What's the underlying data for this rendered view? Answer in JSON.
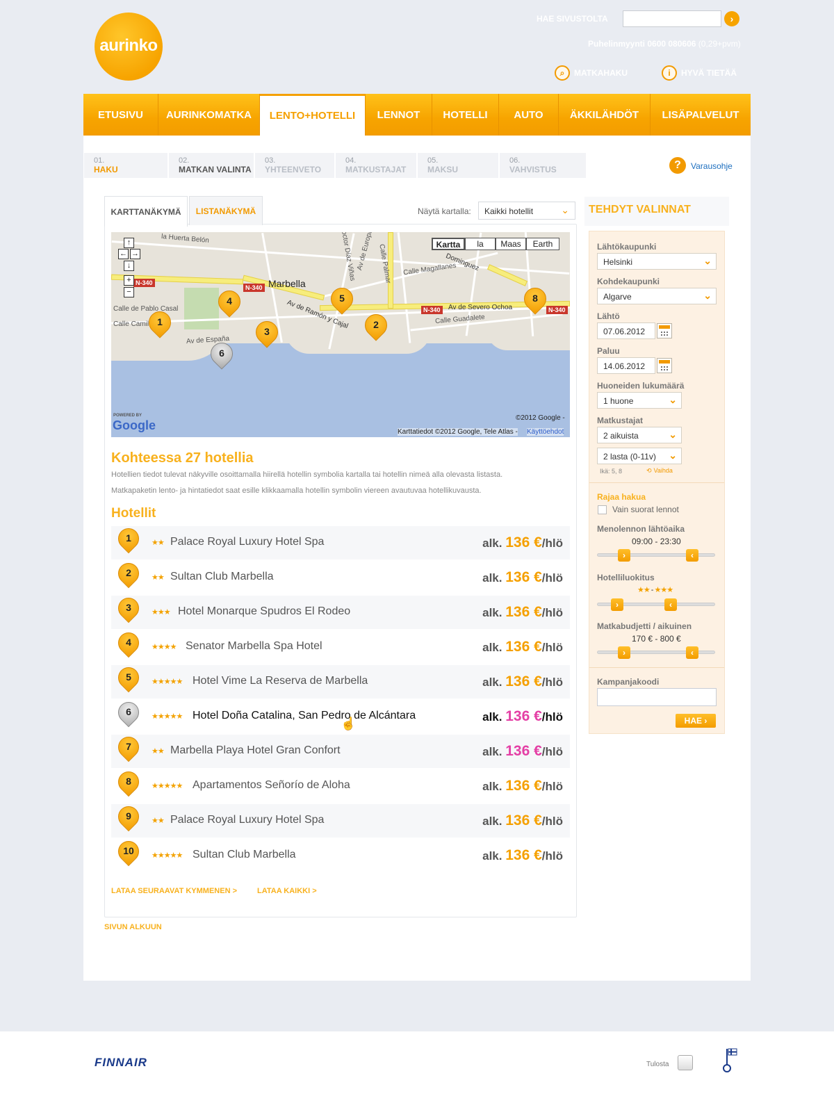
{
  "header": {
    "logo_text": "aurinko",
    "search_label": "HAE SIVUSTOLTA",
    "search_placeholder": "",
    "phone_text": "Puhelinmyynti 0600 080606",
    "phone_price": "(0,29+pvm)",
    "links": [
      "MATKAHAKU",
      "HYVÄ TIETÄÄ"
    ]
  },
  "nav": [
    "ETUSIVU",
    "AURINKOMATKA",
    "LENTO+HOTELLI",
    "LENNOT",
    "HOTELLI",
    "AUTO",
    "ÄKKILÄHDÖT",
    "LISÄPALVELUT"
  ],
  "steps": [
    {
      "num": "01.",
      "label": "HAKU"
    },
    {
      "num": "02.",
      "label": "MATKAN VALINTA"
    },
    {
      "num": "03.",
      "label": "YHTEENVETO"
    },
    {
      "num": "04.",
      "label": "MATKUSTAJAT"
    },
    {
      "num": "05.",
      "label": "MAKSU"
    },
    {
      "num": "06.",
      "label": "VAHVISTUS"
    }
  ],
  "help_label": "Varausohje",
  "tabs": [
    "KARTTANÄKYMÄ",
    "LISTANÄKYMÄ"
  ],
  "map_filter": {
    "label": "Näytä kartalla:",
    "value": "Kaikki hotellit"
  },
  "map": {
    "type_buttons": [
      "Kartta",
      "la",
      "Maas",
      "Earth"
    ],
    "city": "Marbella",
    "streets": [
      "la Huerta Belón",
      "Calle de Pablo Casal",
      "Calle Camilo",
      "Av de España",
      "Av de Ramón y Cajal",
      "Av de Severo Ochoa",
      "Calle Guadalete",
      "Calle Magallanes",
      "Doctor Díaz Viñas",
      "Av de Europa",
      "Calle Palmar",
      "Dominguez"
    ],
    "road_badge": "N-340",
    "powered": "POWERED BY",
    "google": "Google",
    "copyright": "©2012 Google -",
    "attribution": "Karttatiedot ©2012 Google, Tele Atlas -",
    "terms": "Käyttöehdot",
    "markers": [
      "1",
      "2",
      "3",
      "4",
      "5",
      "6",
      "8"
    ]
  },
  "destination": {
    "title": "Kohteessa 27 hotellia",
    "desc1": "Hotellien tiedot tulevat näkyville osoittamalla hiirellä hotellin symbolia kartalla tai hotellin nimeä alla olevasta listasta.",
    "desc2": "Matkapaketin lento- ja hintatiedot saat esille klikkaamalla hotellin symbolin viereen avautuvaa hotellikuvausta."
  },
  "hotels_title": "Hotellit",
  "hotels": [
    {
      "num": "1",
      "stars": "★★",
      "name": "Palace Royal Luxury Hotel Spa",
      "prefix": "alk.",
      "amount": "136 €",
      "suffix": "/hlö"
    },
    {
      "num": "2",
      "stars": "★★",
      "name": "Sultan Club Marbella",
      "prefix": "alk.",
      "amount": "136 €",
      "suffix": "/hlö"
    },
    {
      "num": "3",
      "stars": "★★★",
      "name": "Hotel Monarque Spudros El Rodeo",
      "prefix": "alk.",
      "amount": "136 €",
      "suffix": "/hlö"
    },
    {
      "num": "4",
      "stars": "★★★★",
      "name": "Senator Marbella Spa Hotel",
      "prefix": "alk.",
      "amount": "136 €",
      "suffix": "/hlö"
    },
    {
      "num": "5",
      "stars": "★★★★★",
      "name": "Hotel Vime La Reserva de Marbella",
      "prefix": "alk.",
      "amount": "136 €",
      "suffix": "/hlö"
    },
    {
      "num": "6",
      "stars": "★★★★★",
      "name": "Hotel Doña Catalina, San Pedro de Alcántara",
      "prefix": "alk.",
      "amount": "136 €",
      "suffix": "/hlö"
    },
    {
      "num": "7",
      "stars": "★★",
      "name": "Marbella Playa Hotel Gran Confort",
      "prefix": "alk.",
      "amount": "136 €",
      "suffix": "/hlö"
    },
    {
      "num": "8",
      "stars": "★★★★★",
      "name": "Apartamentos Señorío de Aloha",
      "prefix": "alk.",
      "amount": "136 €",
      "suffix": "/hlö"
    },
    {
      "num": "9",
      "stars": "★★",
      "name": "Palace Royal Luxury Hotel Spa",
      "prefix": "alk.",
      "amount": "136 €",
      "suffix": "/hlö"
    },
    {
      "num": "10",
      "stars": "★★★★★",
      "name": "Sultan Club Marbella",
      "prefix": "alk.",
      "amount": "136 €",
      "suffix": "/hlö"
    }
  ],
  "load_next": "LATAA SEURAAVAT KYMMENEN >",
  "load_all": "LATAA KAIKKI >",
  "back_to_top": "SIVUN ALKUUN",
  "sidebar": {
    "title": "TEHDYT VALINNAT",
    "departure_city_label": "Lähtökaupunki",
    "departure_city": "Helsinki",
    "dest_city_label": "Kohdekaupunki",
    "dest_city": "Algarve",
    "depart_label": "Lähtö",
    "depart_date": "07.06.2012",
    "return_label": "Paluu",
    "return_date": "14.06.2012",
    "rooms_label": "Huoneiden lukumäärä",
    "rooms": "1 huone",
    "travellers_label": "Matkustajat",
    "adults": "2 aikuista",
    "children": "2 lasta (0-11v)",
    "ages": "Ikä: 5, 8",
    "change": "Vaihda",
    "filter_title": "Rajaa hakua",
    "direct_only": "Vain suorat lennot",
    "departure_time_label": "Menolennon lähtöaika",
    "departure_time": "09:00 - 23:30",
    "hotel_class_label": "Hotelliluokitus",
    "hotel_class_min": "★★",
    "hotel_class_sep": " - ",
    "hotel_class_max": "★★★",
    "budget_label": "Matkabudjetti / aikuinen",
    "budget": "170 € - 800 €",
    "campaign_label": "Kampanjakoodi",
    "search_button": "HAE"
  },
  "footer": {
    "finnair": "FINNAIR",
    "print": "Tulosta"
  },
  "colors": {
    "accent": "#f5a000",
    "hover_price": "#e43fa5",
    "link": "#1d6fbf"
  }
}
